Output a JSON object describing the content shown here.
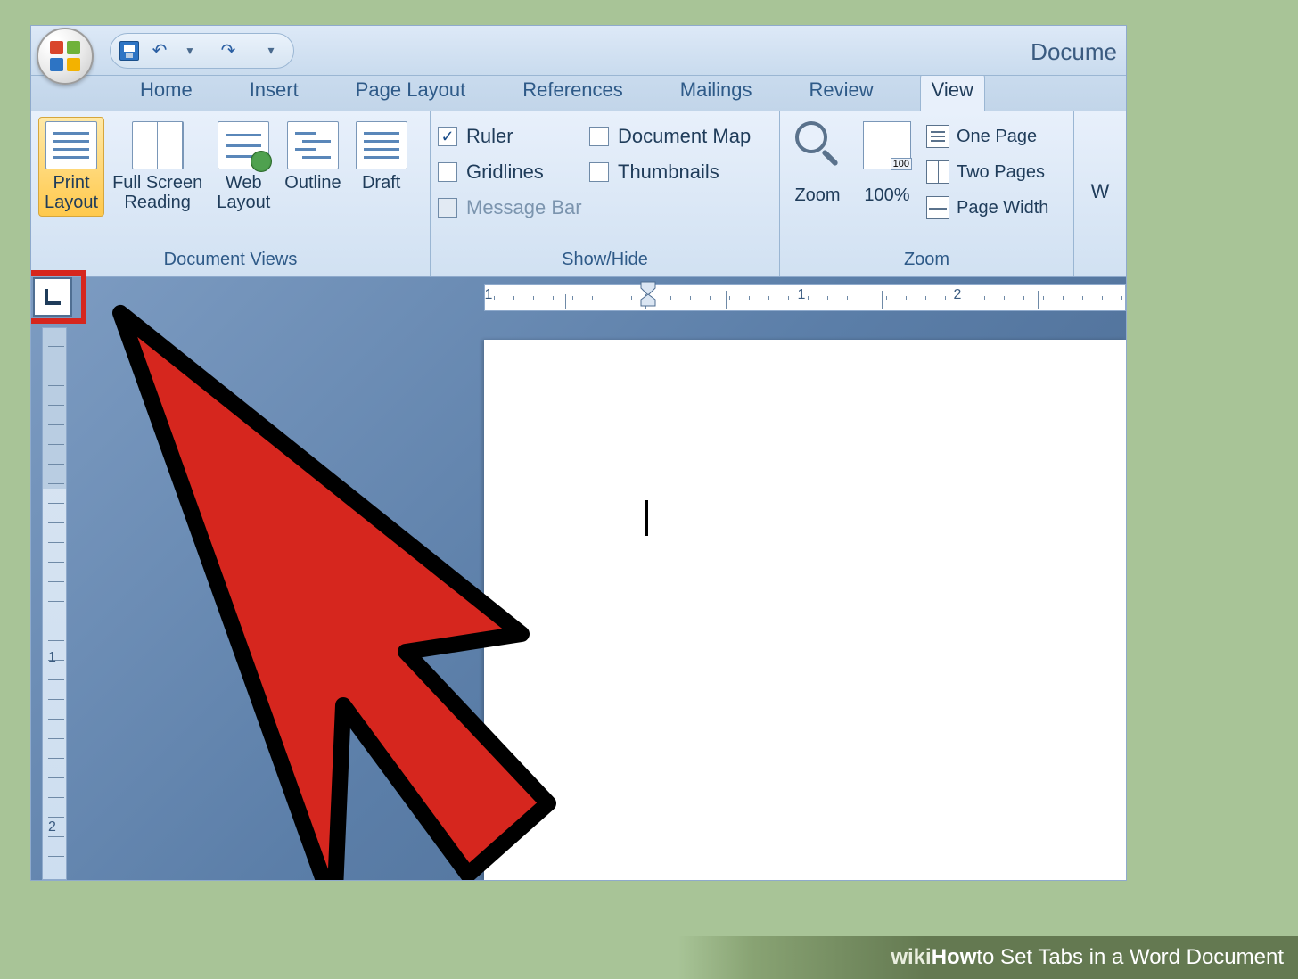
{
  "title_partial": "Docume",
  "ribbon_tabs": [
    "Home",
    "Insert",
    "Page Layout",
    "References",
    "Mailings",
    "Review",
    "View"
  ],
  "active_tab_index": 6,
  "groups": {
    "document_views": {
      "label": "Document Views",
      "buttons": [
        {
          "label": "Print\nLayout",
          "active": true
        },
        {
          "label": "Full Screen\nReading",
          "active": false
        },
        {
          "label": "Web\nLayout",
          "active": false
        },
        {
          "label": "Outline",
          "active": false
        },
        {
          "label": "Draft",
          "active": false
        }
      ]
    },
    "show_hide": {
      "label": "Show/Hide",
      "checks": [
        {
          "label": "Ruler",
          "checked": true
        },
        {
          "label": "Gridlines",
          "checked": false
        },
        {
          "label": "Message Bar",
          "checked": false,
          "disabled": true
        },
        {
          "label": "Document Map",
          "checked": false
        },
        {
          "label": "Thumbnails",
          "checked": false
        }
      ]
    },
    "zoom": {
      "label": "Zoom",
      "zoom_btn": "Zoom",
      "pct_btn": "100%",
      "options": [
        "One Page",
        "Two Pages",
        "Page Width"
      ]
    },
    "window_partial": "W"
  },
  "ruler": {
    "h_numbers": [
      "1",
      "1",
      "2"
    ],
    "v_numbers": [
      "1",
      "2"
    ]
  },
  "caption": {
    "wiki": "wiki",
    "how": "How",
    "rest": " to Set Tabs in a Word Document"
  }
}
